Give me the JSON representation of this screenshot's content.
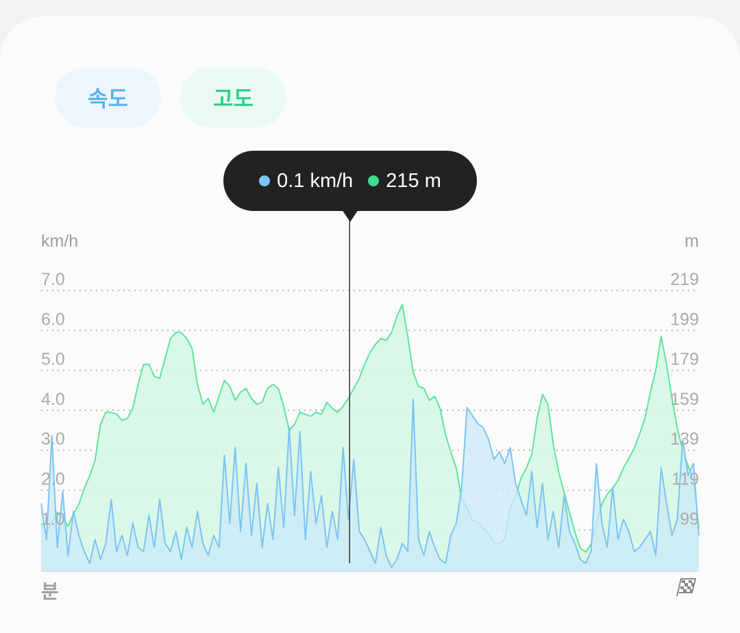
{
  "tabs": [
    {
      "label": "속도",
      "color": "#5ab4f0"
    },
    {
      "label": "고도",
      "color": "#2fd088"
    }
  ],
  "tooltip": {
    "speed": "0.1 km/h",
    "altitude": "215 m",
    "speed_color": "#7cc4f4",
    "altitude_color": "#3ddc8f"
  },
  "icons": {
    "finish": "checkered-flag-icon"
  },
  "chart_data": {
    "type": "area",
    "xlabel": "분",
    "y_left": {
      "unit": "km/h",
      "ticks": [
        "7.0",
        "6.0",
        "5.0",
        "4.0",
        "3.0",
        "2.0",
        "1.0"
      ],
      "range": [
        0,
        7.0
      ]
    },
    "y_right": {
      "unit": "m",
      "ticks": [
        "219",
        "199",
        "179",
        "159",
        "139",
        "119",
        "99"
      ],
      "range": [
        79,
        219
      ]
    },
    "grid": true,
    "cursor": {
      "x_fraction": 0.469,
      "speed": 0.1,
      "altitude": 215
    },
    "series": [
      {
        "key": "altitude",
        "axis": "right",
        "color": "#5ee39e",
        "fill": "#d6f7e6",
        "values": [
          102,
          98,
          103,
          108,
          105,
          101,
          107,
          112,
          120,
          126,
          134,
          152,
          158,
          158,
          157,
          154,
          155,
          160,
          172,
          182,
          182,
          176,
          175,
          185,
          195,
          198,
          198,
          195,
          190,
          172,
          162,
          165,
          158,
          166,
          174,
          171,
          164,
          168,
          170,
          165,
          162,
          163,
          170,
          172,
          170,
          161,
          149,
          152,
          158,
          157,
          156,
          158,
          157,
          163,
          160,
          158,
          161,
          165,
          170,
          175,
          182,
          188,
          192,
          195,
          194,
          198,
          206,
          212,
          196,
          178,
          171,
          170,
          164,
          166,
          160,
          147,
          138,
          130,
          115,
          110,
          104,
          103,
          100,
          97,
          93,
          92,
          95,
          110,
          116,
          125,
          130,
          137,
          155,
          167,
          162,
          142,
          128,
          118,
          108,
          98,
          90,
          88,
          92,
          103,
          112,
          117,
          120,
          124,
          130,
          135,
          140,
          147,
          155,
          168,
          179,
          196,
          182,
          165,
          150,
          139,
          131,
          124,
          100
        ]
      },
      {
        "key": "speed",
        "axis": "left",
        "color": "#7cc4f4",
        "fill": "#cbeaf8",
        "values": [
          1.7,
          0.8,
          3.4,
          0.6,
          2.0,
          0.4,
          1.5,
          0.9,
          0.5,
          0.2,
          0.8,
          0.3,
          0.7,
          1.8,
          0.5,
          0.9,
          0.4,
          1.2,
          0.6,
          0.5,
          1.4,
          0.6,
          1.8,
          0.7,
          0.5,
          1.0,
          0.3,
          1.1,
          0.6,
          1.5,
          0.7,
          0.4,
          0.9,
          0.6,
          2.9,
          1.2,
          3.1,
          1.0,
          2.7,
          0.9,
          2.2,
          0.6,
          1.7,
          0.8,
          2.6,
          1.1,
          3.6,
          1.4,
          3.5,
          0.8,
          2.5,
          1.2,
          1.9,
          0.6,
          1.5,
          0.8,
          3.1,
          1.3,
          2.8,
          1.0,
          0.8,
          0.5,
          0.2,
          1.1,
          0.4,
          0.1,
          0.3,
          0.7,
          0.5,
          4.3,
          0.8,
          0.4,
          1.0,
          0.6,
          0.3,
          0.2,
          0.9,
          1.2,
          2.1,
          4.1,
          3.9,
          3.7,
          3.6,
          3.3,
          2.8,
          3.0,
          2.7,
          3.1,
          2.2,
          1.8,
          1.4,
          2.5,
          1.1,
          2.2,
          0.8,
          1.5,
          0.6,
          1.9,
          1.0,
          0.7,
          0.3,
          0.2,
          0.5,
          2.7,
          1.2,
          0.6,
          2.1,
          0.8,
          1.3,
          1.0,
          0.5,
          0.6,
          0.8,
          1.0,
          0.4,
          2.6,
          1.7,
          0.9,
          1.3,
          3.3,
          2.4,
          2.7,
          0.9
        ]
      }
    ]
  }
}
